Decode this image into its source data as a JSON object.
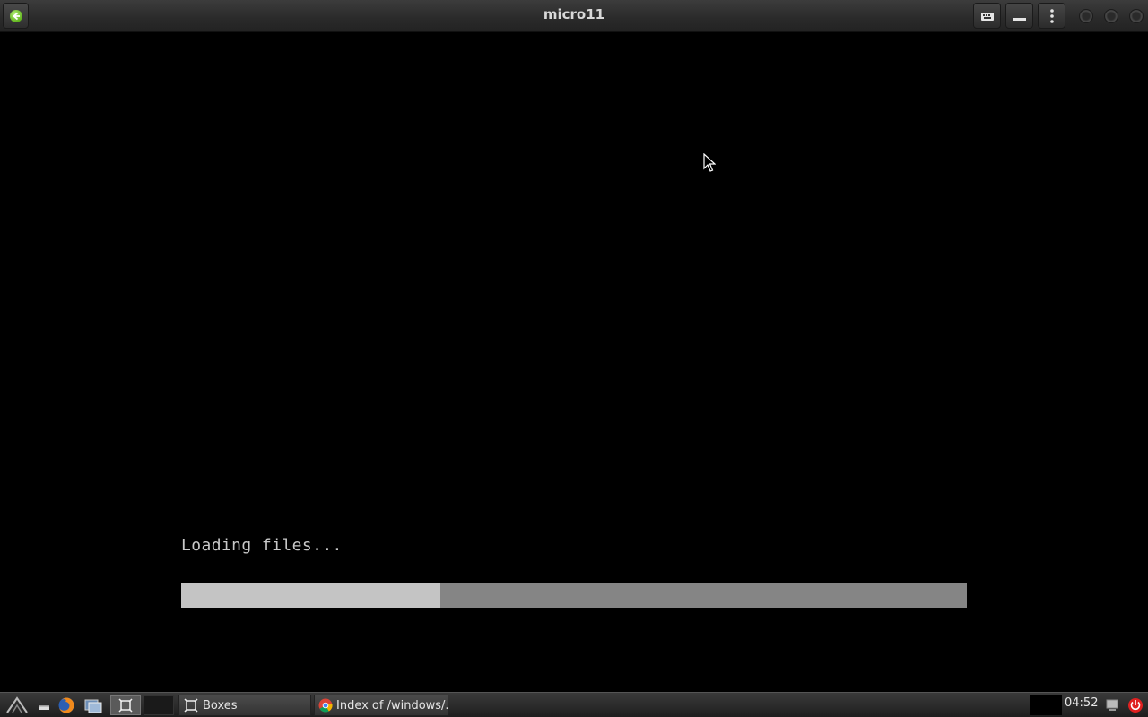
{
  "window": {
    "title": "micro11"
  },
  "vm_screen": {
    "status_text": "Loading files...",
    "progress_percent": 33
  },
  "taskbar": {
    "launchers": [
      "menu-icon",
      "show-desktop-icon",
      "firefox-icon",
      "file-manager-icon",
      "boxes-icon",
      "blank-launcher"
    ],
    "tasks": [
      {
        "label": "Boxes",
        "icon": "boxes-icon"
      },
      {
        "label": "Index of /windows/...",
        "icon": "chrome-icon"
      }
    ],
    "clock": "04:52"
  },
  "colors": {
    "progress_fill": "#c4c4c4",
    "progress_track": "#858585",
    "back_button": "#5fb31c",
    "power": "#e02020"
  }
}
